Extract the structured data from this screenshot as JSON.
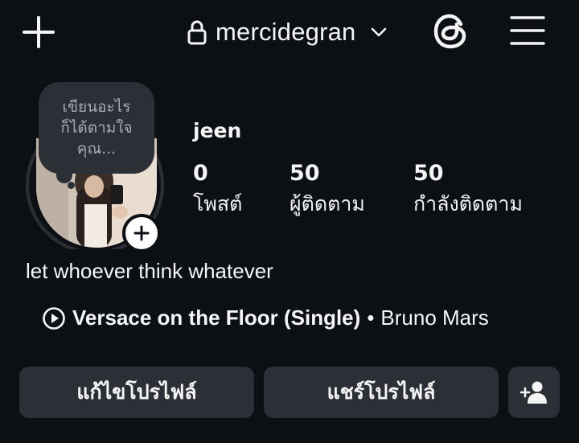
{
  "header": {
    "username": "mercidegran",
    "icons": {
      "create": "plus-icon",
      "lock": "lock-icon",
      "switch_account": "chevron-down-icon",
      "threads": "threads-icon",
      "menu": "hamburger-menu-icon"
    }
  },
  "profile": {
    "note": "เขียนอะไร ก็ได้ตามใจ คุณ...",
    "display_name": "jeen",
    "stats": [
      {
        "value": "0",
        "label": "โพสต์"
      },
      {
        "value": "50",
        "label": "ผู้ติดตาม"
      },
      {
        "value": "50",
        "label": "กำลังติดตาม"
      }
    ],
    "bio": "let whoever think whatever",
    "music": {
      "song": "Versace on the Floor (Single)",
      "separator": "•",
      "artist": "Bruno Mars"
    }
  },
  "actions": {
    "edit_profile": "แก้ไขโปรไฟล์",
    "share_profile": "แชร์โปรไฟล์",
    "add_person_icon": "person-add-icon"
  },
  "colors": {
    "background": "#0c1015",
    "button": "#2c3036",
    "text": "#f5f5f5",
    "note_text": "#a8abb0"
  }
}
